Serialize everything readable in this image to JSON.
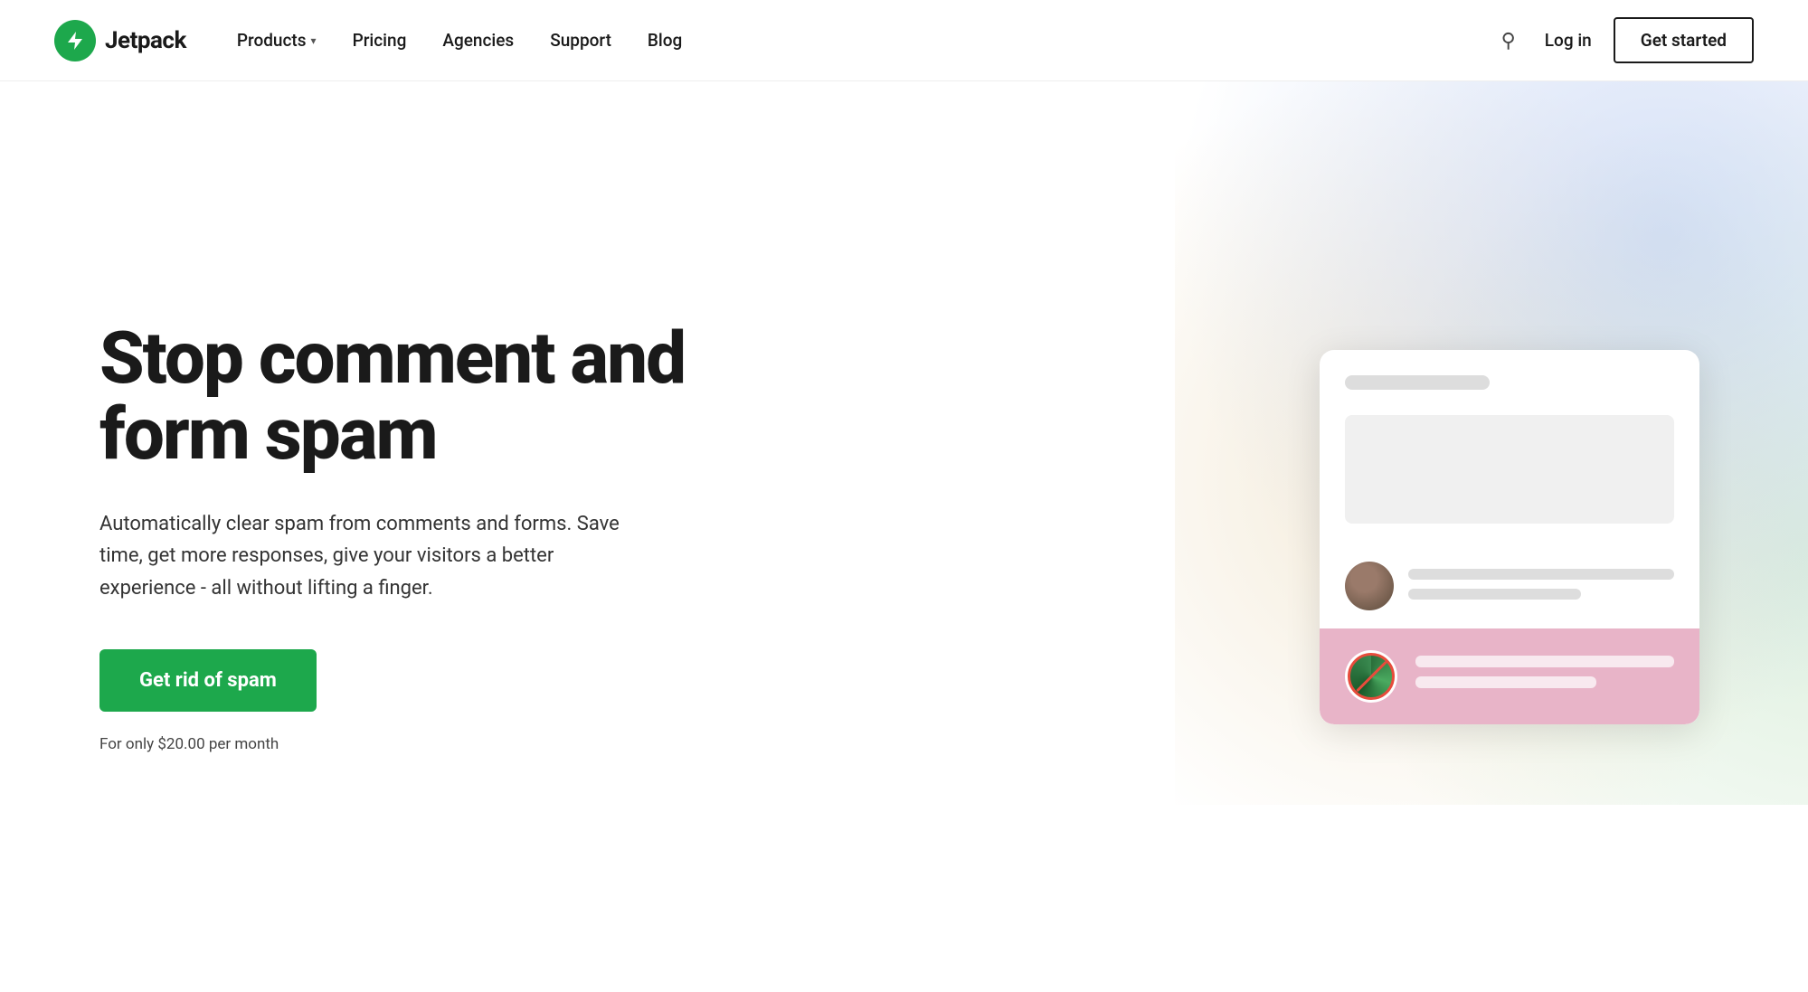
{
  "brand": {
    "name": "Jetpack",
    "logo_alt": "Jetpack Logo"
  },
  "nav": {
    "items": [
      {
        "label": "Products",
        "has_dropdown": true
      },
      {
        "label": "Pricing",
        "has_dropdown": false
      },
      {
        "label": "Agencies",
        "has_dropdown": false
      },
      {
        "label": "Support",
        "has_dropdown": false
      },
      {
        "label": "Blog",
        "has_dropdown": false
      }
    ]
  },
  "header": {
    "login_label": "Log in",
    "get_started_label": "Get started",
    "search_icon": "🔍"
  },
  "hero": {
    "title": "Stop comment and form spam",
    "description": "Automatically clear spam from comments and forms. Save time, get more responses, give your visitors a better experience - all without lifting a finger.",
    "cta_label": "Get rid of spam",
    "price_note": "For only $20.00 per month"
  },
  "colors": {
    "green_primary": "#1da84c",
    "text_dark": "#1a1a1a",
    "text_muted": "#444"
  }
}
